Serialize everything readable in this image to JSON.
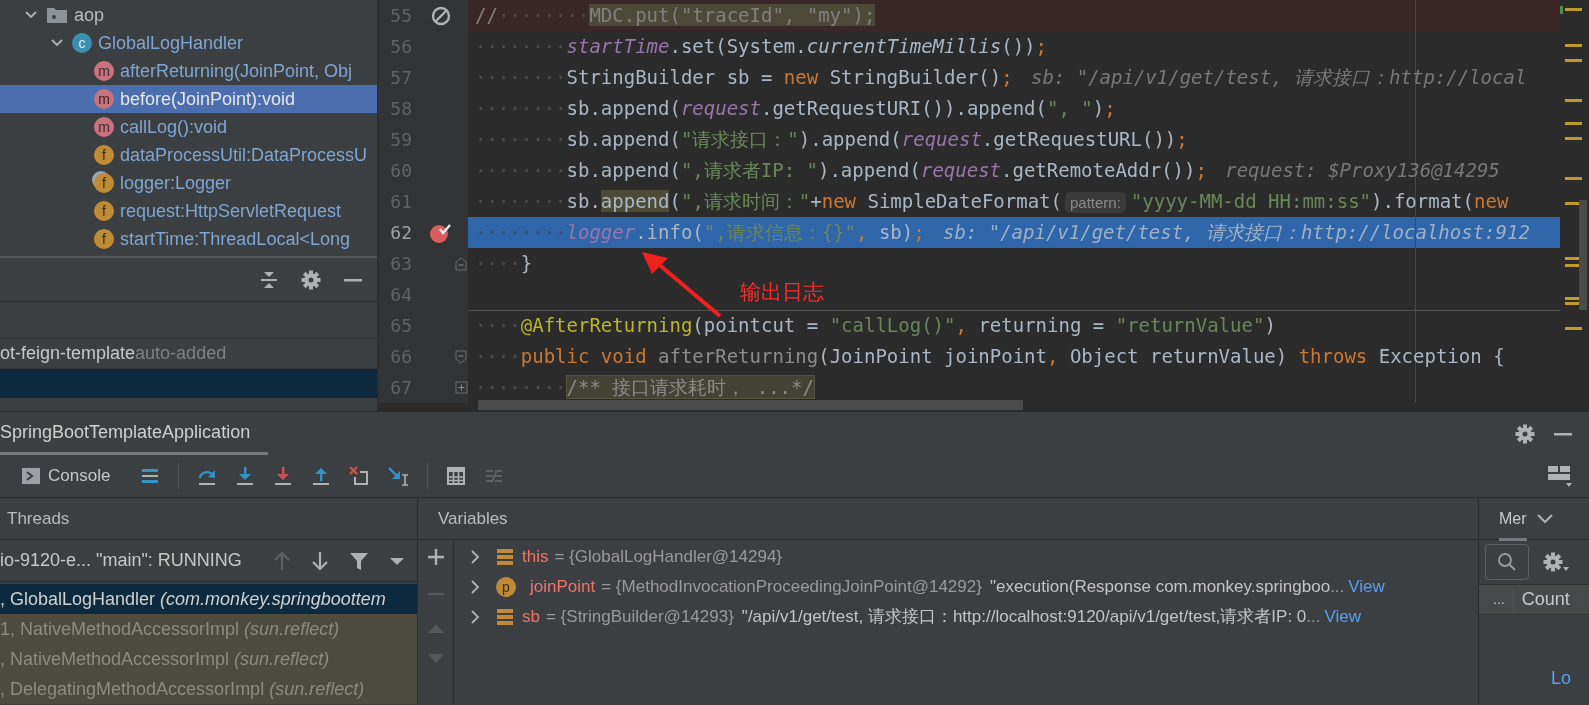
{
  "project_tree": [
    {
      "kind": "folder",
      "label": "aop",
      "expanded": true,
      "selected": false,
      "children": [
        {
          "kind": "class",
          "badge": "c",
          "label": "GlobalLogHandler",
          "expanded": true,
          "selected": false,
          "children": [
            {
              "kind": "method",
              "badge": "m",
              "label": "afterReturning(JoinPoint, Obj",
              "selected": false
            },
            {
              "kind": "method",
              "badge": "m",
              "label": "before(JoinPoint):void",
              "selected": true
            },
            {
              "kind": "method",
              "badge": "m",
              "label": "callLog():void",
              "selected": false
            },
            {
              "kind": "field",
              "badge": "f",
              "label": "dataProcessUtil:DataProcessU",
              "selected": false
            },
            {
              "kind": "static_field",
              "badge": "f",
              "label": "logger:Logger",
              "selected": false
            },
            {
              "kind": "field",
              "badge": "f",
              "label": "request:HttpServletRequest",
              "selected": false
            },
            {
              "kind": "field",
              "badge": "f",
              "label": "startTime:ThreadLocal<Long",
              "selected": false
            }
          ]
        }
      ]
    }
  ],
  "side_panel": {
    "toolbar": [
      {
        "kind": "collapse"
      },
      {
        "kind": "settings"
      },
      {
        "kind": "minimize"
      }
    ],
    "rows": [
      {
        "name": "ot-feign-template",
        "note": "auto-added",
        "selected": false
      },
      {
        "selected": true
      }
    ]
  },
  "editor": {
    "lines": [
      {
        "number": "55",
        "current": false,
        "changed": true,
        "breakpoint": {
          "kind": "muted"
        },
        "tokens": [
          {
            "kind": "comment",
            "text": "//"
          },
          {
            "kind": "ws",
            "text": "········"
          },
          {
            "kind": "commentmatch",
            "text": "MDC.put(\"traceId\", \"my\");"
          }
        ]
      },
      {
        "number": "56",
        "current": false,
        "changed": false,
        "tokens": [
          {
            "kind": "ws",
            "text": "········"
          },
          {
            "kind": "field",
            "text": "startTime"
          },
          {
            "kind": "plain",
            "text": ".set(System."
          },
          {
            "kind": "static",
            "text": "currentTimeMillis"
          },
          {
            "kind": "plain",
            "text": "())"
          },
          {
            "kind": "keyword",
            "text": ";"
          }
        ]
      },
      {
        "number": "57",
        "current": false,
        "changed": false,
        "tokens": [
          {
            "kind": "ws",
            "text": "········"
          },
          {
            "kind": "plain",
            "text": "StringBuilder sb = "
          },
          {
            "kind": "keyword",
            "text": "new"
          },
          {
            "kind": "plain",
            "text": " StringBuilder()"
          },
          {
            "kind": "keyword",
            "text": ";"
          },
          {
            "kind": "hint",
            "text": "sb: \"/api/v1/get/test, 请求接口：http://local"
          }
        ]
      },
      {
        "number": "58",
        "current": false,
        "changed": false,
        "tokens": [
          {
            "kind": "ws",
            "text": "········"
          },
          {
            "kind": "plain",
            "text": "sb.append("
          },
          {
            "kind": "field",
            "text": "request"
          },
          {
            "kind": "plain",
            "text": ".getRequestURI()).append("
          },
          {
            "kind": "string",
            "text": "\", \""
          },
          {
            "kind": "plain",
            "text": ")"
          },
          {
            "kind": "keyword",
            "text": ";"
          }
        ]
      },
      {
        "number": "59",
        "current": false,
        "changed": false,
        "tokens": [
          {
            "kind": "ws",
            "text": "········"
          },
          {
            "kind": "plain",
            "text": "sb.append("
          },
          {
            "kind": "string",
            "text": "\"请求接口：\""
          },
          {
            "kind": "plain",
            "text": ").append("
          },
          {
            "kind": "field",
            "text": "request"
          },
          {
            "kind": "plain",
            "text": ".getRequestURL())"
          },
          {
            "kind": "keyword",
            "text": ";"
          }
        ]
      },
      {
        "number": "60",
        "current": false,
        "changed": false,
        "tokens": [
          {
            "kind": "ws",
            "text": "········"
          },
          {
            "kind": "plain",
            "text": "sb.append("
          },
          {
            "kind": "string",
            "text": "\",请求者IP: \""
          },
          {
            "kind": "plain",
            "text": ").append("
          },
          {
            "kind": "field",
            "text": "request"
          },
          {
            "kind": "plain",
            "text": ".getRemoteAddr())"
          },
          {
            "kind": "keyword",
            "text": ";"
          },
          {
            "kind": "hint",
            "text": "request: $Proxy136@14295"
          }
        ]
      },
      {
        "number": "61",
        "current": false,
        "changed": false,
        "tokens": [
          {
            "kind": "ws",
            "text": "········"
          },
          {
            "kind": "plain",
            "text": "sb."
          },
          {
            "kind": "match",
            "text": "append"
          },
          {
            "kind": "plain",
            "text": "("
          },
          {
            "kind": "string",
            "text": "\",请求时间：\""
          },
          {
            "kind": "plain",
            "text": "+"
          },
          {
            "kind": "keyword",
            "text": "new"
          },
          {
            "kind": "plain",
            "text": " SimpleDateFormat("
          },
          {
            "kind": "param",
            "text": "pattern:"
          },
          {
            "kind": "string",
            "text": "\"yyyy-MM-dd HH:mm:ss\""
          },
          {
            "kind": "plain",
            "text": ").format("
          },
          {
            "kind": "keyword",
            "text": "new"
          }
        ]
      },
      {
        "number": "62",
        "current": true,
        "changed": false,
        "breakpoint": {
          "kind": "verified"
        },
        "tokens": [
          {
            "kind": "ws",
            "text": "········"
          },
          {
            "kind": "field",
            "text": "logger"
          },
          {
            "kind": "plain",
            "text": ".info("
          },
          {
            "kind": "string",
            "text": "\",请求信息：{}\""
          },
          {
            "kind": "keyword",
            "text": ","
          },
          {
            "kind": "plain",
            "text": " sb)"
          },
          {
            "kind": "keyword",
            "text": ";"
          },
          {
            "kind": "hint",
            "text": "sb: \"/api/v1/get/test, 请求接口：http://localhost:912"
          }
        ]
      },
      {
        "number": "63",
        "current": false,
        "changed": false,
        "fold": {
          "kind": "end"
        },
        "tokens": [
          {
            "kind": "ws",
            "text": "····"
          },
          {
            "kind": "plain",
            "text": "}"
          }
        ]
      },
      {
        "number": "64",
        "current": false,
        "changed": false
      },
      {
        "number": "65",
        "current": false,
        "changed": false,
        "separator": true,
        "tokens": [
          {
            "kind": "ws",
            "text": "····"
          },
          {
            "kind": "annotation",
            "text": "@AfterReturning"
          },
          {
            "kind": "plain",
            "text": "(pointcut = "
          },
          {
            "kind": "string",
            "text": "\"callLog()\""
          },
          {
            "kind": "keyword",
            "text": ","
          },
          {
            "kind": "plain",
            "text": " returning = "
          },
          {
            "kind": "string",
            "text": "\"returnValue\""
          },
          {
            "kind": "plain",
            "text": ")"
          }
        ]
      },
      {
        "number": "66",
        "current": false,
        "changed": false,
        "fold": {
          "kind": "start"
        },
        "tokens": [
          {
            "kind": "ws",
            "text": "····"
          },
          {
            "kind": "keyword",
            "text": "public void"
          },
          {
            "kind": "dim",
            "text": " afterReturning"
          },
          {
            "kind": "plain",
            "text": "(JoinPoint joinPoint"
          },
          {
            "kind": "keyword",
            "text": ","
          },
          {
            "kind": "plain",
            "text": " Object returnValue) "
          },
          {
            "kind": "keyword",
            "text": "throws"
          },
          {
            "kind": "plain",
            "text": " Exception {"
          }
        ]
      },
      {
        "number": "67",
        "current": false,
        "changed": false,
        "fold": {
          "kind": "collapsed"
        },
        "tokens": [
          {
            "kind": "ws",
            "text": "········"
          },
          {
            "kind": "folded",
            "text": "/** 接口请求耗时， ...*/"
          }
        ]
      }
    ],
    "annotation": {
      "text": "输出日志"
    }
  },
  "debug": {
    "run_tab": {
      "label": "SpringBootTemplateApplication",
      "selected": true
    },
    "header_actions": [
      {
        "kind": "settings"
      },
      {
        "kind": "minimize"
      }
    ],
    "console_tab": {
      "label": "Console",
      "selected": false
    },
    "toolbar": [
      {
        "kind": "frames",
        "disabled": false
      },
      {
        "kind": "step_over",
        "disabled": false
      },
      {
        "kind": "step_into",
        "disabled": false
      },
      {
        "kind": "force_step_into",
        "disabled": false
      },
      {
        "kind": "step_out",
        "disabled": false
      },
      {
        "kind": "drop_frame",
        "disabled": false
      },
      {
        "kind": "run_to_cursor",
        "disabled": false
      },
      {
        "kind": "evaluate",
        "disabled": false
      },
      {
        "kind": "trace",
        "disabled": true
      }
    ],
    "threads": {
      "title": "Threads",
      "thread": "io-9120-e... \"main\": RUNNING",
      "actions": [
        {
          "kind": "up",
          "disabled": true
        },
        {
          "kind": "down",
          "disabled": false
        },
        {
          "kind": "filter",
          "disabled": false
        },
        {
          "kind": "dropdown",
          "disabled": false
        }
      ],
      "frames": [
        {
          "method": ", GlobalLogHandler",
          "package": "(com.monkey.springboottem",
          "selected": true,
          "library": false
        },
        {
          "method": "1, NativeMethodAccessorImpl",
          "package": "(sun.reflect)",
          "selected": false,
          "library": true
        },
        {
          "method": ", NativeMethodAccessorImpl",
          "package": "(sun.reflect)",
          "selected": false,
          "library": true
        },
        {
          "method": ", DelegatingMethodAccessorImpl",
          "package": "(sun.reflect)",
          "selected": false,
          "library": true
        }
      ]
    },
    "variables": {
      "title": "Variables",
      "actions": [
        {
          "kind": "add",
          "disabled": false
        },
        {
          "kind": "remove",
          "disabled": true
        },
        {
          "kind": "up",
          "disabled": true
        },
        {
          "kind": "down",
          "disabled": true
        }
      ],
      "rows": [
        {
          "kind": "object",
          "name": "this",
          "type": "= {GlobalLogHandler@14294}",
          "expanded": false
        },
        {
          "kind": "param",
          "badge": "p",
          "name": "joinPoint",
          "type": "= {MethodInvocationProceedingJoinPoint@14292}",
          "value": "\"execution(Response com.monkey.springboo",
          "ellipsis": "...",
          "link": "View",
          "expanded": false
        },
        {
          "kind": "object",
          "name": "sb",
          "type": "= {StringBuilder@14293}",
          "value": "\"/api/v1/get/test, 请求接口：http://localhost:9120/api/v1/get/test,请求者IP: 0",
          "ellipsis": "...",
          "link": "View",
          "expanded": false
        }
      ]
    },
    "memory": {
      "tab": {
        "label": "Mer",
        "selected": true
      },
      "columns": [
        "...",
        "Count"
      ],
      "link": "Lo"
    }
  }
}
